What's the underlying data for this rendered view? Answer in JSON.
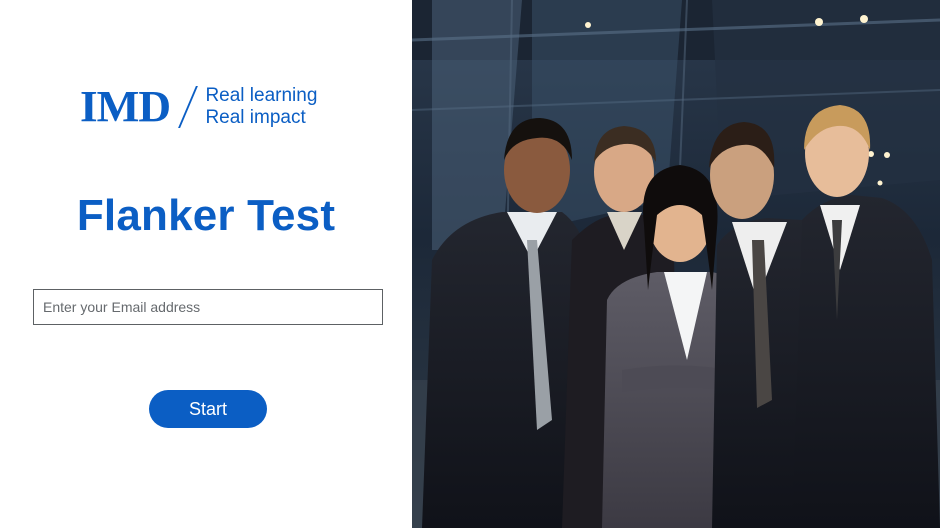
{
  "logo": {
    "wordmark": "IMD",
    "tagline_line1": "Real learning",
    "tagline_line2": "Real impact"
  },
  "title": "Flanker Test",
  "email_input": {
    "placeholder": "Enter your Email address",
    "value": ""
  },
  "start_button": {
    "label": "Start"
  },
  "colors": {
    "brand_blue": "#0b5ec4",
    "input_border": "#5d6164",
    "background": "#ffffff"
  },
  "hero_image": {
    "description_icon": "business-team-photo"
  }
}
